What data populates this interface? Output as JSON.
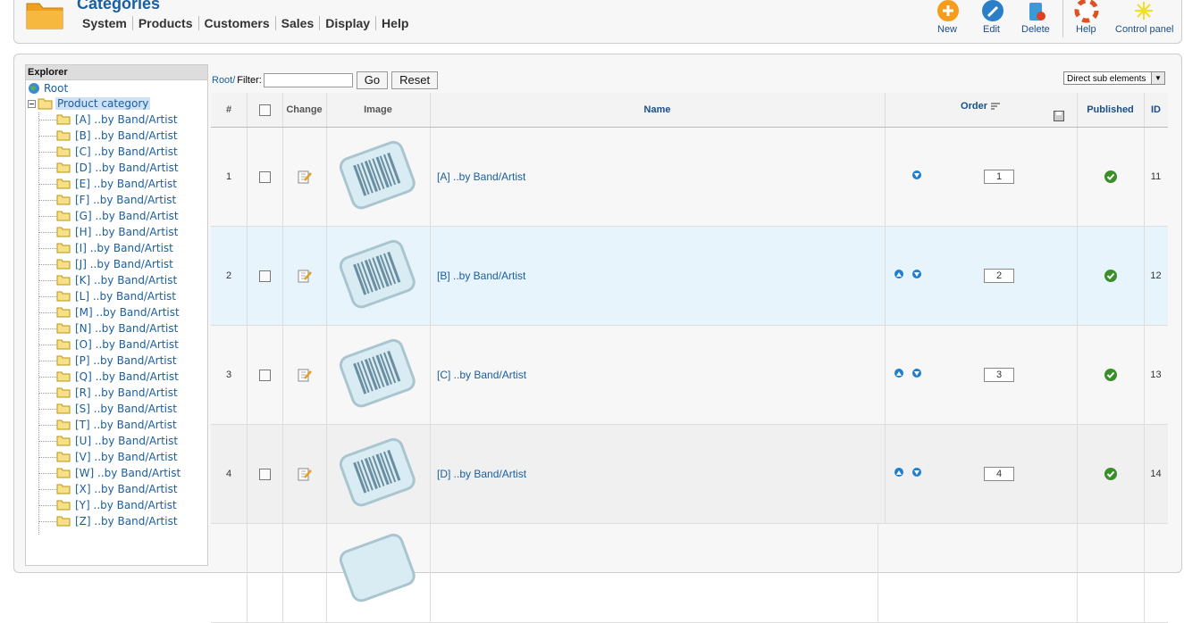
{
  "header": {
    "title": "Categories",
    "menu": [
      "System",
      "Products",
      "Customers",
      "Sales",
      "Display",
      "Help"
    ],
    "toolbar": [
      {
        "label": "New",
        "icon": "new-icon"
      },
      {
        "label": "Edit",
        "icon": "edit-icon"
      },
      {
        "label": "Delete",
        "icon": "delete-icon"
      },
      {
        "label": "Help",
        "icon": "help-icon"
      },
      {
        "label": "Control panel",
        "icon": "control-panel-icon"
      }
    ]
  },
  "explorer": {
    "title": "Explorer",
    "root": "Root",
    "category": "Product category",
    "items": [
      "[A] ..by Band/Artist",
      "[B] ..by Band/Artist",
      "[C] ..by Band/Artist",
      "[D] ..by Band/Artist",
      "[E] ..by Band/Artist",
      "[F] ..by Band/Artist",
      "[G] ..by Band/Artist",
      "[H] ..by Band/Artist",
      "[I] ..by Band/Artist",
      "[J] ..by Band/Artist",
      "[K] ..by Band/Artist",
      "[L] ..by Band/Artist",
      "[M] ..by Band/Artist",
      "[N] ..by Band/Artist",
      "[O] ..by Band/Artist",
      "[P] ..by Band/Artist",
      "[Q] ..by Band/Artist",
      "[R] ..by Band/Artist",
      "[S] ..by Band/Artist",
      "[T] ..by Band/Artist",
      "[U] ..by Band/Artist",
      "[V] ..by Band/Artist",
      "[W] ..by Band/Artist",
      "[X] ..by Band/Artist",
      "[Y] ..by Band/Artist",
      "[Z] ..by Band/Artist"
    ]
  },
  "filter": {
    "root_link": "Root/",
    "label": "Filter:",
    "value": "",
    "go": "Go",
    "reset": "Reset",
    "view_select": "Direct sub elements"
  },
  "grid": {
    "headers": {
      "num": "#",
      "change": "Change",
      "image": "Image",
      "name": "Name",
      "order": "Order",
      "published": "Published",
      "id": "ID"
    },
    "rows": [
      {
        "num": "1",
        "name": "[A] ..by Band/Artist",
        "order": "1",
        "id": "11",
        "up": false,
        "down": true
      },
      {
        "num": "2",
        "name": "[B] ..by Band/Artist",
        "order": "2",
        "id": "12",
        "up": true,
        "down": true
      },
      {
        "num": "3",
        "name": "[C] ..by Band/Artist",
        "order": "3",
        "id": "13",
        "up": true,
        "down": true
      },
      {
        "num": "4",
        "name": "[D] ..by Band/Artist",
        "order": "4",
        "id": "14",
        "up": true,
        "down": true
      }
    ]
  },
  "colors": {
    "link": "#1a5fa0",
    "highlight_row": "#e8f4fc",
    "published": "#3a8f2a"
  }
}
